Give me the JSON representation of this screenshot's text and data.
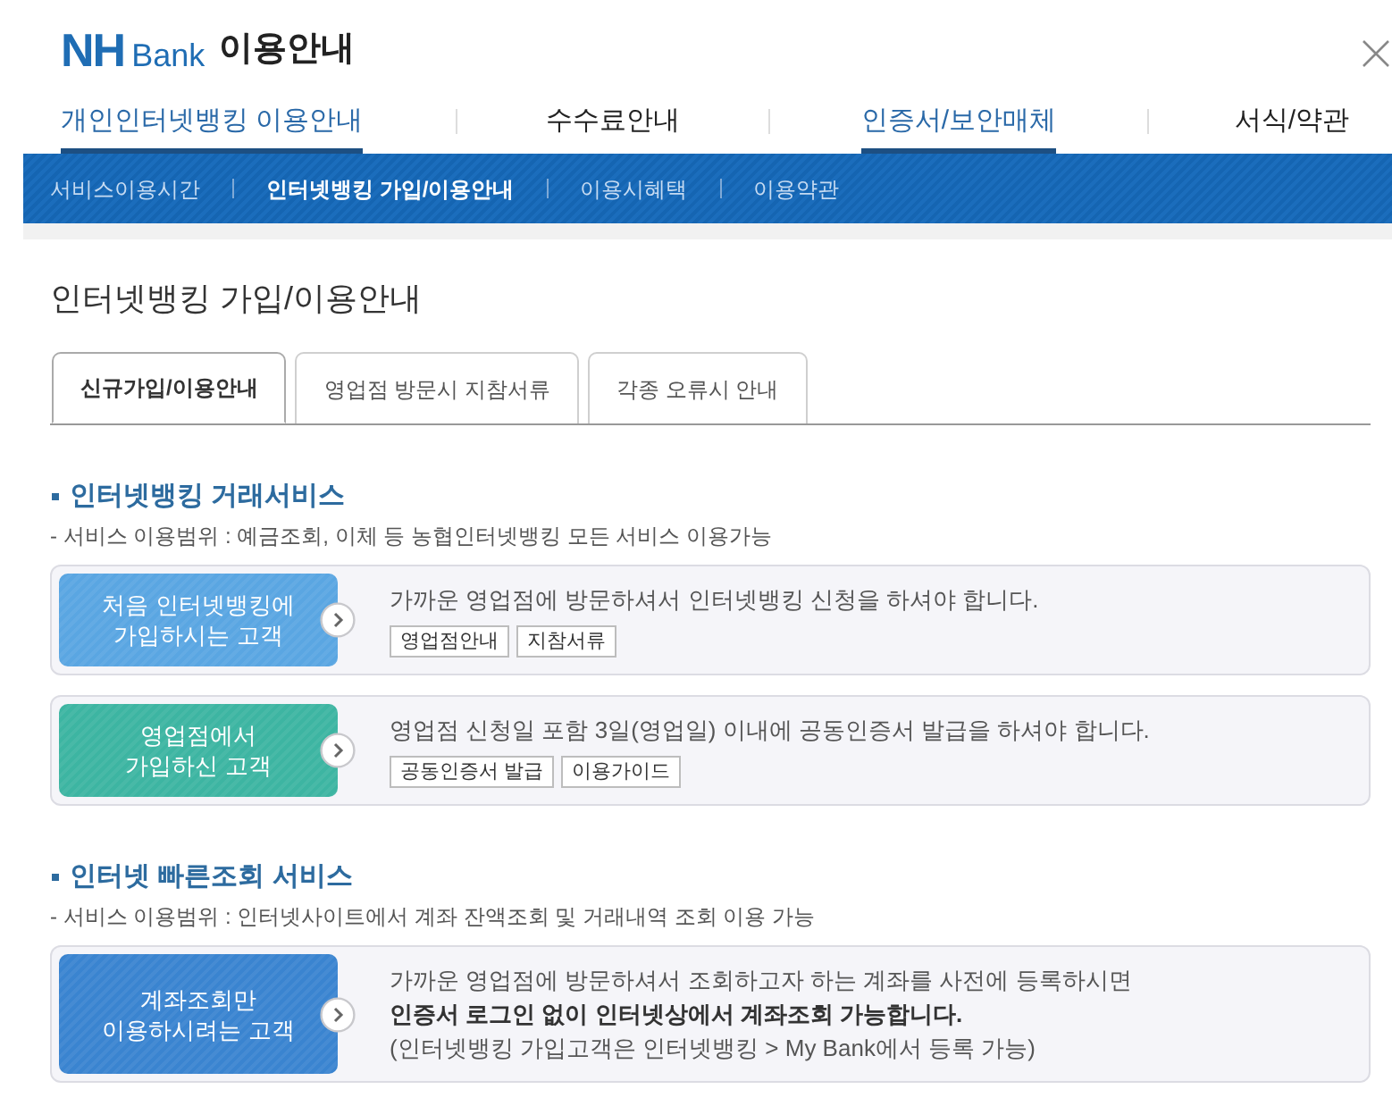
{
  "header": {
    "logo": {
      "mark": "NH",
      "word": "Bank"
    },
    "title": "이용안내"
  },
  "main_nav": [
    {
      "label": "개인인터넷뱅킹 이용안내",
      "selected": true
    },
    {
      "label": "수수료안내",
      "selected": false
    },
    {
      "label": "인증서/보안매체",
      "selected": true
    },
    {
      "label": "서식/약관",
      "selected": false
    }
  ],
  "sub_nav": [
    {
      "label": "서비스이용시간",
      "selected": false
    },
    {
      "label": "인터넷뱅킹 가입/이용안내",
      "selected": true
    },
    {
      "label": "이용시혜택",
      "selected": false
    },
    {
      "label": "이용약관",
      "selected": false
    }
  ],
  "page_title": "인터넷뱅킹 가입/이용안내",
  "tabs": [
    {
      "label": "신규가입/이용안내",
      "selected": true
    },
    {
      "label": "영업점 방문시 지참서류",
      "selected": false
    },
    {
      "label": "각종 오류시 안내",
      "selected": false
    }
  ],
  "sections": [
    {
      "heading": "인터넷뱅킹 거래서비스",
      "scope": "- 서비스 이용범위 : 예금조회, 이체 등 농협인터넷뱅킹 모든 서비스 이용가능",
      "cards": [
        {
          "button": {
            "label": "처음 인터넷뱅킹에\n가입하시는 고객",
            "color": "#5aa6e2"
          },
          "description": "가까운 영업점에 방문하셔서 인터넷뱅킹 신청을 하셔야 합니다.",
          "links": [
            "영업점안내",
            "지참서류"
          ]
        },
        {
          "button": {
            "label": "영업점에서\n가입하신 고객",
            "color": "#3db5a2"
          },
          "description": "영업점 신청일 포함 3일(영업일) 이내에 공동인증서 발급을 하셔야 합니다.",
          "links": [
            "공동인증서 발급",
            "이용가이드"
          ]
        }
      ]
    },
    {
      "heading": "인터넷 빠른조회 서비스",
      "scope": "- 서비스 이용범위 : 인터넷사이트에서 계좌 잔액조회 및 거래내역 조회 이용 가능",
      "cards": [
        {
          "button": {
            "label": "계좌조회만\n이용하시려는 고객",
            "color": "#3a84d0"
          },
          "description": "가까운 영업점에 방문하셔서 조회하고자 하는 계좌를 사전에 등록하시면\n**인증서 로그인 없이 인터넷상에서 계좌조회 가능합니다.**\n(인터넷뱅킹 가입고객은 인터넷뱅킹 > My Bank에서 등록 가능)"
        }
      ]
    }
  ]
}
